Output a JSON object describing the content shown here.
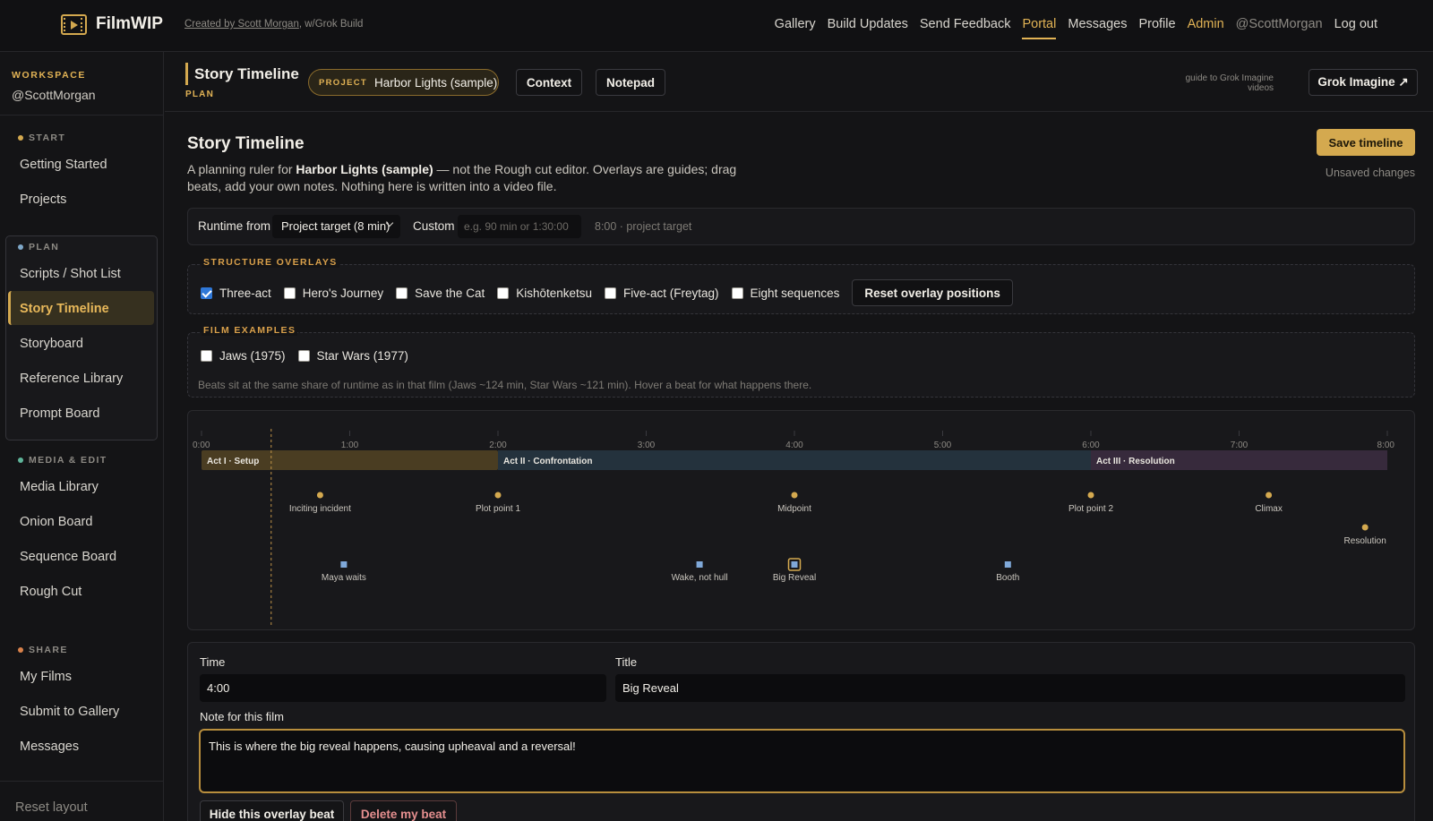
{
  "app": {
    "brand": "FilmWIP",
    "credit_link": "Created by Scott Morgan",
    "credit_suffix": ", w/Grok Build"
  },
  "topnav": [
    "Gallery",
    "Build Updates",
    "Send Feedback",
    "Portal",
    "Messages",
    "Profile",
    "Admin",
    "@ScottMorgan",
    "Log out"
  ],
  "topnav_active": "Portal",
  "sidebar": {
    "workspace_label": "WORKSPACE",
    "workspace_name": "@ScottMorgan",
    "sections": {
      "start": {
        "label": "START",
        "color": "#d4a94f",
        "items": [
          "Getting Started",
          "Projects"
        ]
      },
      "plan": {
        "label": "PLAN",
        "color": "#7fa8c9",
        "items": [
          "Scripts / Shot List",
          "Story Timeline",
          "Storyboard",
          "Reference Library",
          "Prompt Board"
        ]
      },
      "media": {
        "label": "MEDIA & EDIT",
        "color": "#5fb59a",
        "items": [
          "Media Library",
          "Onion Board",
          "Sequence Board",
          "Rough Cut"
        ]
      },
      "share": {
        "label": "SHARE",
        "color": "#d9824b",
        "items": [
          "My Films",
          "Submit to Gallery",
          "Messages"
        ]
      }
    },
    "active_item": "Story Timeline",
    "reset_layout": "Reset layout"
  },
  "header": {
    "title": "Story Timeline",
    "subtitle": "PLAN",
    "project_label": "PROJECT",
    "project_name": "Harbor Lights (sample)",
    "context_btn": "Context",
    "notepad_btn": "Notepad",
    "guide_note": "guide to Grok Imagine videos",
    "grok_btn": "Grok Imagine ↗"
  },
  "main": {
    "title": "Story Timeline",
    "desc_pre": "A planning ruler for ",
    "desc_bold": "Harbor Lights (sample)",
    "desc_post": " — not the Rough cut editor. Overlays are guides; drag beats, add your own notes. Nothing here is written into a video file.",
    "save_btn": "Save timeline",
    "unsaved": "Unsaved changes"
  },
  "runtime": {
    "label": "Runtime from",
    "select_value": "Project target (8 min)",
    "custom_label": "Custom",
    "custom_placeholder": "e.g. 90 min or 1:30:00",
    "note": "8:00 · project target"
  },
  "overlays": {
    "title": "STRUCTURE OVERLAYS",
    "items": [
      {
        "label": "Three-act",
        "checked": true
      },
      {
        "label": "Hero's Journey",
        "checked": false
      },
      {
        "label": "Save the Cat",
        "checked": false
      },
      {
        "label": "Kishōtenketsu",
        "checked": false
      },
      {
        "label": "Five-act (Freytag)",
        "checked": false
      },
      {
        "label": "Eight sequences",
        "checked": false
      }
    ],
    "reset_btn": "Reset overlay positions"
  },
  "film_examples": {
    "title": "FILM EXAMPLES",
    "items": [
      {
        "label": "Jaws (1975)",
        "checked": false
      },
      {
        "label": "Star Wars (1977)",
        "checked": false
      }
    ],
    "note": "Beats sit at the same share of runtime as in that film (Jaws ~124 min, Star Wars ~121 min). Hover a beat for what happens there."
  },
  "timeline": {
    "duration_min": 8,
    "ticks": [
      "0:00",
      "1:00",
      "2:00",
      "3:00",
      "4:00",
      "5:00",
      "6:00",
      "7:00",
      "8:00"
    ],
    "playhead_min": 0.47,
    "acts": [
      {
        "label": "Act I · Setup",
        "start": 0,
        "end": 2,
        "color": "#4a3d22"
      },
      {
        "label": "Act II · Confrontation",
        "start": 2,
        "end": 6,
        "color": "#24323d"
      },
      {
        "label": "Act III · Resolution",
        "start": 6,
        "end": 8,
        "color": "#372a3c"
      }
    ],
    "overlay_beats": [
      {
        "label": "Inciting incident",
        "t": 0.8,
        "row": 0
      },
      {
        "label": "Plot point 1",
        "t": 2.0,
        "row": 0
      },
      {
        "label": "Midpoint",
        "t": 4.0,
        "row": 0
      },
      {
        "label": "Plot point 2",
        "t": 6.0,
        "row": 0
      },
      {
        "label": "Climax",
        "t": 7.2,
        "row": 0
      },
      {
        "label": "Resolution",
        "t": 7.85,
        "row": 1
      }
    ],
    "my_beats": [
      {
        "label": "Maya waits",
        "t": 0.96,
        "selected": false
      },
      {
        "label": "Wake, not hull",
        "t": 3.36,
        "selected": false
      },
      {
        "label": "Big Reveal",
        "t": 4.0,
        "selected": true
      },
      {
        "label": "Booth",
        "t": 5.44,
        "selected": false
      }
    ],
    "beat_color": "#d4a94f",
    "my_beat_color": "#7fa8d9"
  },
  "editor": {
    "time_label": "Time",
    "time_value": "4:00",
    "title_label": "Title",
    "title_value": "Big Reveal",
    "note_label": "Note for this film",
    "note_value": "This is where the big reveal happens, causing upheaval and a reversal!",
    "hide_btn": "Hide this overlay beat",
    "delete_btn": "Delete my beat"
  }
}
